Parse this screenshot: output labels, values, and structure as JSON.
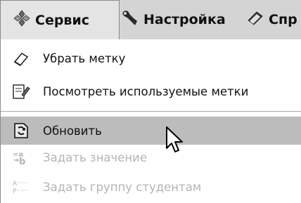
{
  "menubar": {
    "items": [
      {
        "label": "Сервис",
        "icon": "wrench-diamond-icon"
      },
      {
        "label": "Настройка",
        "icon": "wrench-icon"
      },
      {
        "label": "Спр",
        "icon": "book-icon"
      }
    ]
  },
  "dropdown": {
    "items": [
      {
        "label": "Убрать метку",
        "icon": "eraser-icon",
        "enabled": true
      },
      {
        "label": "Посмотреть используемые метки",
        "icon": "view-labels-icon",
        "enabled": true
      },
      {
        "label": "Обновить",
        "icon": "refresh-icon",
        "enabled": true,
        "highlighted": true
      },
      {
        "label": "Задать значение",
        "icon": "set-value-icon",
        "enabled": false
      },
      {
        "label": "Задать группу студентам",
        "icon": "group-icon",
        "enabled": false
      }
    ]
  },
  "colors": {
    "menubar_bg": "#d4d4d4",
    "highlight": "#bcbcbc",
    "disabled_text": "#b4b4b4"
  }
}
